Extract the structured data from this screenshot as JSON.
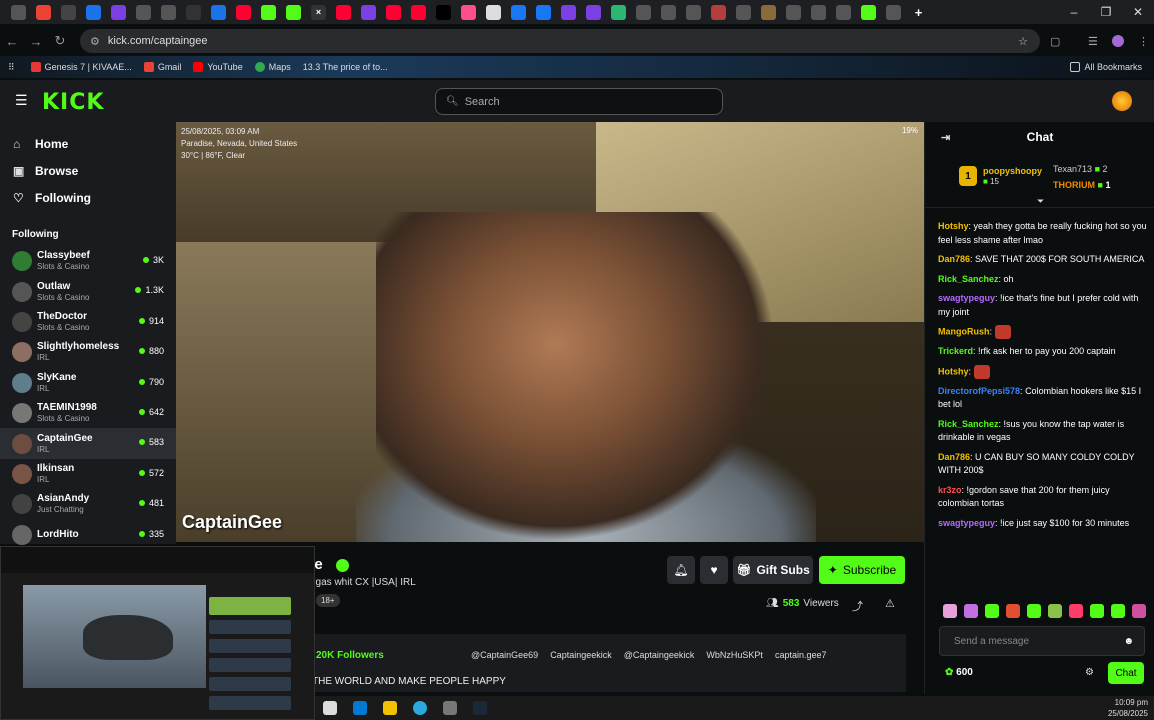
{
  "browser": {
    "url": "kick.com/captaingee",
    "bookmarks": [
      "Genesis 7 | KIVAAE...",
      "Gmail",
      "YouTube",
      "Maps",
      "13.3 The price of to..."
    ],
    "all_bookmarks": "All Bookmarks"
  },
  "header": {
    "logo": "KICK",
    "search_placeholder": "Search"
  },
  "nav": {
    "home": "Home",
    "browse": "Browse",
    "following": "Following"
  },
  "following": {
    "heading": "Following",
    "channels": [
      {
        "name": "Classybeef",
        "category": "Slots & Casino",
        "viewers": "3K"
      },
      {
        "name": "Outlaw",
        "category": "Slots & Casino",
        "viewers": "1.3K"
      },
      {
        "name": "TheDoctor",
        "category": "Slots & Casino",
        "viewers": "914"
      },
      {
        "name": "Slightlyhomeless",
        "category": "IRL",
        "viewers": "880"
      },
      {
        "name": "SlyKane",
        "category": "IRL",
        "viewers": "790"
      },
      {
        "name": "TAEMIN1998",
        "category": "Slots & Casino",
        "viewers": "642"
      },
      {
        "name": "CaptainGee",
        "category": "IRL",
        "viewers": "583"
      },
      {
        "name": "Ilkinsan",
        "category": "IRL",
        "viewers": "572"
      },
      {
        "name": "AsianAndy",
        "category": "Just Chatting",
        "viewers": "481"
      },
      {
        "name": "LordHito",
        "category": "",
        "viewers": "335"
      }
    ]
  },
  "video": {
    "overlay_date": "25/08/2025, 03:09 AM",
    "overlay_location": "Paradise, Nevada, United States",
    "overlay_weather": "30°C | 86°F, Clear",
    "battery": "19%",
    "watermark": "CaptainGee"
  },
  "stream": {
    "channel_name": "ee",
    "title": "egas whit CX |USA| IRL",
    "rating": "18+",
    "gift_label": "Gift Subs",
    "subscribe_label": "Subscribe",
    "viewers_count": "583",
    "viewers_label": "Viewers",
    "followers": "20K Followers",
    "socials": [
      "@CaptainGee69",
      "Captaingeekick",
      "@Captaingeekick",
      "WbNzHuSKPt",
      "captain.gee7"
    ],
    "description": "THE WORLD AND MAKE PEOPLE HAPPY"
  },
  "chat": {
    "title": "Chat",
    "leaderboard": {
      "first_name": "poopyshoopy",
      "first_count": "15",
      "second": "Texan713",
      "second_count": "2",
      "third": "THORIUM",
      "third_count": "1"
    },
    "messages": [
      {
        "user": "Hotshy",
        "color": "#f2c100",
        "text": "yeah they gotta be really fucking hot so you feel less shame after lmao"
      },
      {
        "user": "Dan786",
        "color": "#f2c100",
        "text": "SAVE THAT 200$ FOR SOUTH AMERICA"
      },
      {
        "user": "Rick_Sanchez",
        "color": "#53fc18",
        "text": "oh"
      },
      {
        "user": "swagtypeguy",
        "color": "#b36bff",
        "text": "!ice that's fine but I prefer cold with my joint"
      },
      {
        "user": "MangoRush",
        "color": "#f2c100",
        "text": ""
      },
      {
        "user": "Trickerd",
        "color": "#53fc18",
        "text": "!rfk ask her to pay you 200 captain"
      },
      {
        "user": "Hotshy",
        "color": "#f2c100",
        "text": ""
      },
      {
        "user": "DirectorofPepsi578",
        "color": "#3b82f6",
        "text": "Colombian hookers like $15 I bet lol"
      },
      {
        "user": "Rick_Sanchez",
        "color": "#53fc18",
        "text": "!sus you know the tap water is drinkable in vegas"
      },
      {
        "user": "Dan786",
        "color": "#f2c100",
        "text": "U CAN BUY SO MANY COLDY COLDY WITH 200$"
      },
      {
        "user": "kr3zo",
        "color": "#ff4f4f",
        "text": "!gordon save that 200 for them juicy colombian tortas"
      },
      {
        "user": "swagtypeguy",
        "color": "#b36bff",
        "text": "!ice just say $100 for 30 minutes"
      }
    ],
    "input_placeholder": "Send a message",
    "points": "600",
    "send_label": "Chat"
  },
  "taskbar": {
    "time": "10:09 pm",
    "date": "25/08/2025"
  }
}
